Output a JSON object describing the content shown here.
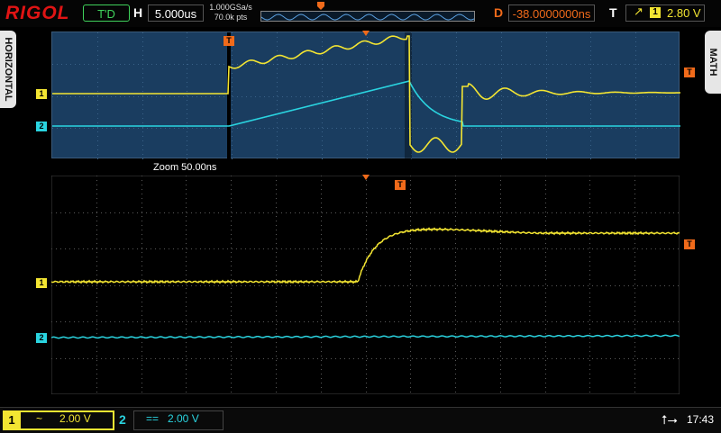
{
  "header": {
    "brand": "RIGOL",
    "trigger_status": "T'D",
    "horizontal_label": "H",
    "timebase": "5.000us",
    "sample_rate": "1.000GSa/s",
    "memory_depth": "70.0k pts",
    "delay_label": "D",
    "trigger_delay": "-38.0000000ns",
    "trigger_label": "T",
    "trigger_source": "1",
    "trigger_level": "2.80 V"
  },
  "side_tabs": {
    "left": "HORIZONTAL",
    "right": "MATH"
  },
  "zoom": {
    "label": "Zoom  50.00ns"
  },
  "markers": {
    "ch1": "1",
    "ch2": "2",
    "trigger": "T"
  },
  "channels": [
    {
      "number": "1",
      "coupling": "~",
      "scale": "2.00 V",
      "color": "#f3e532"
    },
    {
      "number": "2",
      "coupling": "==",
      "scale": "2.00 V",
      "color": "#2ad4e0"
    }
  ],
  "status": {
    "time": "17:43"
  },
  "colors": {
    "accent_trigger": "#f06a1a",
    "brand": "#e01414",
    "status_ok": "#3fd15b"
  }
}
